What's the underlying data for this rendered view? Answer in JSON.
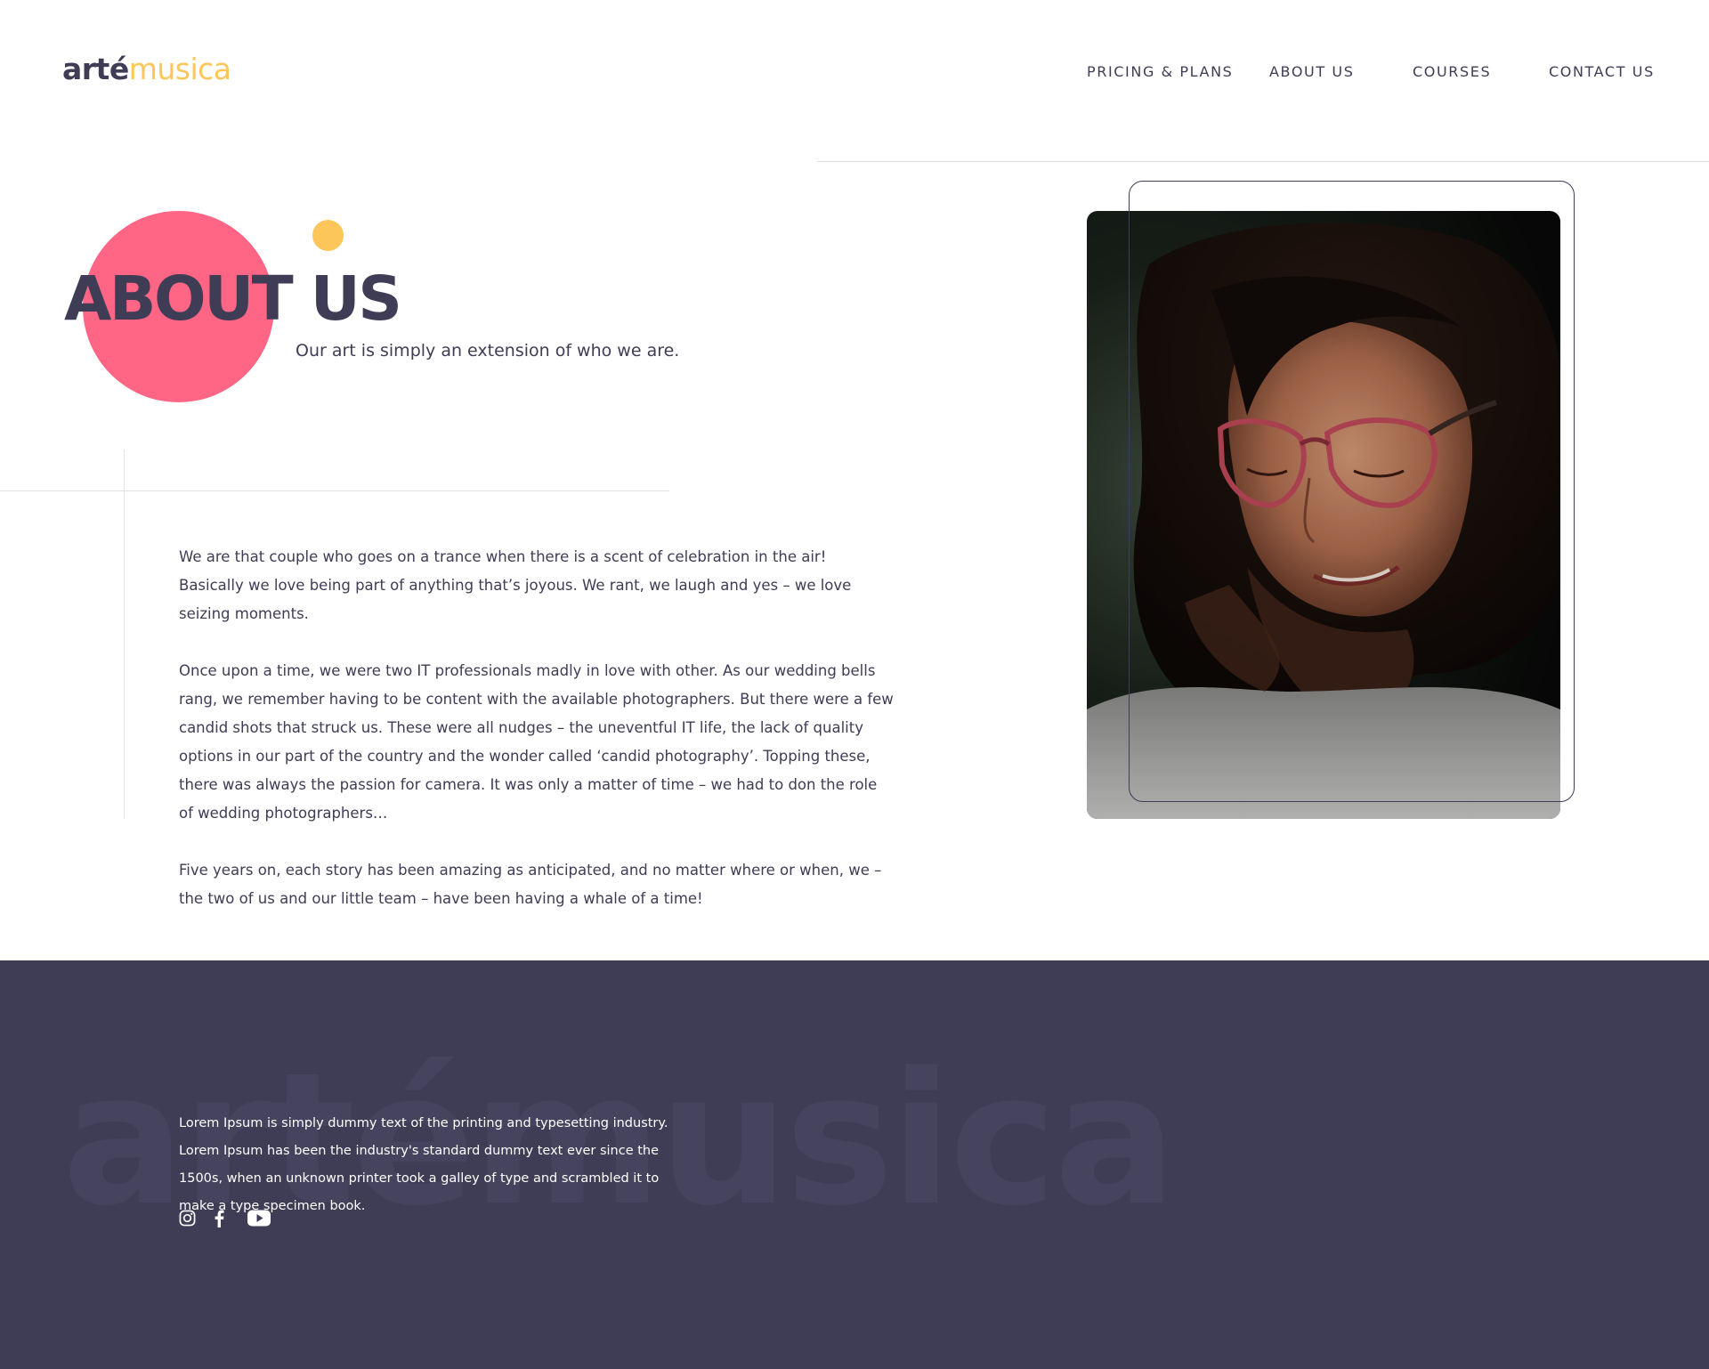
{
  "brand": {
    "logo_part1": "arté",
    "logo_part2": "musica"
  },
  "nav": {
    "items": [
      {
        "label": "PRICING & PLANS"
      },
      {
        "label": "ABOUT US"
      },
      {
        "label": "COURSES"
      },
      {
        "label": "CONTACT US"
      }
    ]
  },
  "hero": {
    "title": "ABOUT US",
    "subtitle": "Our art is simply an extension of who we are."
  },
  "body": {
    "paragraphs": [
      "We are that couple who goes on a trance when there is a scent of celebration in the air! Basically we love being part of anything that’s joyous. We rant, we laugh and yes – we love seizing moments.",
      "Once upon a time, we were two IT professionals madly in love with other. As our wedding bells rang, we remember having to be content with the available photographers. But there were a few candid shots that struck us. These were all nudges – the uneventful IT life, the lack of quality options in our part of the country and the wonder called ‘candid photography’. Topping these, there was always the passion for camera. It was only a matter of time – we had to don the role of wedding photographers…",
      "Five years on, each story has been amazing as anticipated, and no matter where or when, we – the two of us and our little team – have been having a whale of a time!"
    ]
  },
  "photo": {
    "icon": "portrait-photo"
  },
  "footer": {
    "watermark": "artémusica",
    "text": "Lorem Ipsum is simply dummy text of the printing and typesetting industry. Lorem Ipsum has been the industry's standard dummy text ever since the 1500s, when an unknown printer took a galley of type and scrambled it to make a type specimen book.",
    "socials": [
      {
        "icon": "instagram-icon"
      },
      {
        "icon": "facebook-icon"
      },
      {
        "icon": "youtube-icon"
      }
    ]
  },
  "colors": {
    "primary": "#3f3c56",
    "accent_pink": "#ff6584",
    "accent_yellow": "#fcc65a",
    "background": "#ffffff"
  }
}
